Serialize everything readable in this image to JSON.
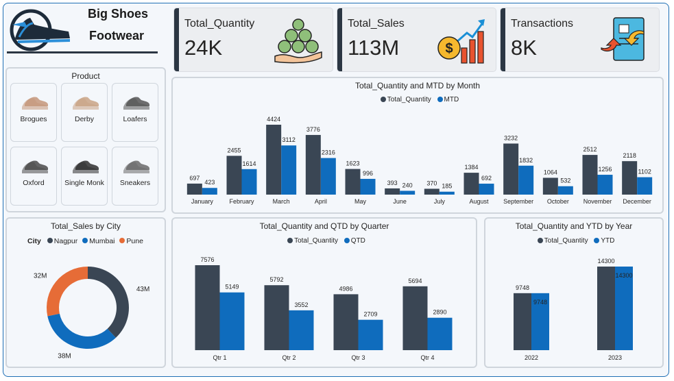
{
  "brand": {
    "line1": "Big Shoes",
    "line2": "Footwear"
  },
  "kpis": [
    {
      "label": "Total_Quantity",
      "value": "24K",
      "icon": "money-bags-hand-icon"
    },
    {
      "label": "Total_Sales",
      "value": "113M",
      "icon": "sales-growth-chart-icon"
    },
    {
      "label": "Transactions",
      "value": "8K",
      "icon": "document-exchange-icon"
    }
  ],
  "product_slicer": {
    "title": "Product",
    "items": [
      "Brogues",
      "Derby",
      "Loafers",
      "Oxford",
      "Single Monk",
      "Sneakers"
    ]
  },
  "colors": {
    "dark": "#3a4654",
    "blue": "#0f6cbd",
    "orange": "#e66c37",
    "border": "#cfd5dc"
  },
  "chart_data": [
    {
      "id": "month",
      "type": "bar",
      "title": "Total_Quantity and MTD by Month",
      "legend": [
        "Total_Quantity",
        "MTD"
      ],
      "categories": [
        "January",
        "February",
        "March",
        "April",
        "May",
        "June",
        "July",
        "August",
        "September",
        "October",
        "November",
        "December"
      ],
      "series": [
        {
          "name": "Total_Quantity",
          "values": [
            697,
            2455,
            4424,
            3776,
            1623,
            393,
            370,
            1384,
            3232,
            1064,
            2512,
            2118
          ]
        },
        {
          "name": "MTD",
          "values": [
            423,
            1614,
            3112,
            2316,
            996,
            240,
            185,
            692,
            1832,
            532,
            1256,
            1102
          ]
        }
      ],
      "ylim": [
        0,
        4424
      ]
    },
    {
      "id": "city",
      "type": "pie",
      "title": "Total_Sales by City",
      "legend_title": "City",
      "categories": [
        "Nagpur",
        "Mumbai",
        "Pune"
      ],
      "values": [
        43,
        38,
        32
      ],
      "labels": [
        "43M",
        "38M",
        "32M"
      ]
    },
    {
      "id": "quarter",
      "type": "bar",
      "title": "Total_Quantity and QTD by Quarter",
      "legend": [
        "Total_Quantity",
        "QTD"
      ],
      "categories": [
        "Qtr 1",
        "Qtr 2",
        "Qtr 3",
        "Qtr 4"
      ],
      "series": [
        {
          "name": "Total_Quantity",
          "values": [
            7576,
            5792,
            4986,
            5694
          ]
        },
        {
          "name": "QTD",
          "values": [
            5149,
            3552,
            2709,
            2890
          ]
        }
      ],
      "ylim": [
        0,
        7576
      ]
    },
    {
      "id": "year",
      "type": "bar",
      "title": "Total_Quantity and YTD by Year",
      "legend": [
        "Total_Quantity",
        "YTD"
      ],
      "categories": [
        "2022",
        "2023"
      ],
      "series": [
        {
          "name": "Total_Quantity",
          "values": [
            9748,
            14300
          ]
        },
        {
          "name": "YTD",
          "values": [
            9748,
            14300
          ]
        }
      ],
      "ylim": [
        0,
        14300
      ]
    }
  ]
}
